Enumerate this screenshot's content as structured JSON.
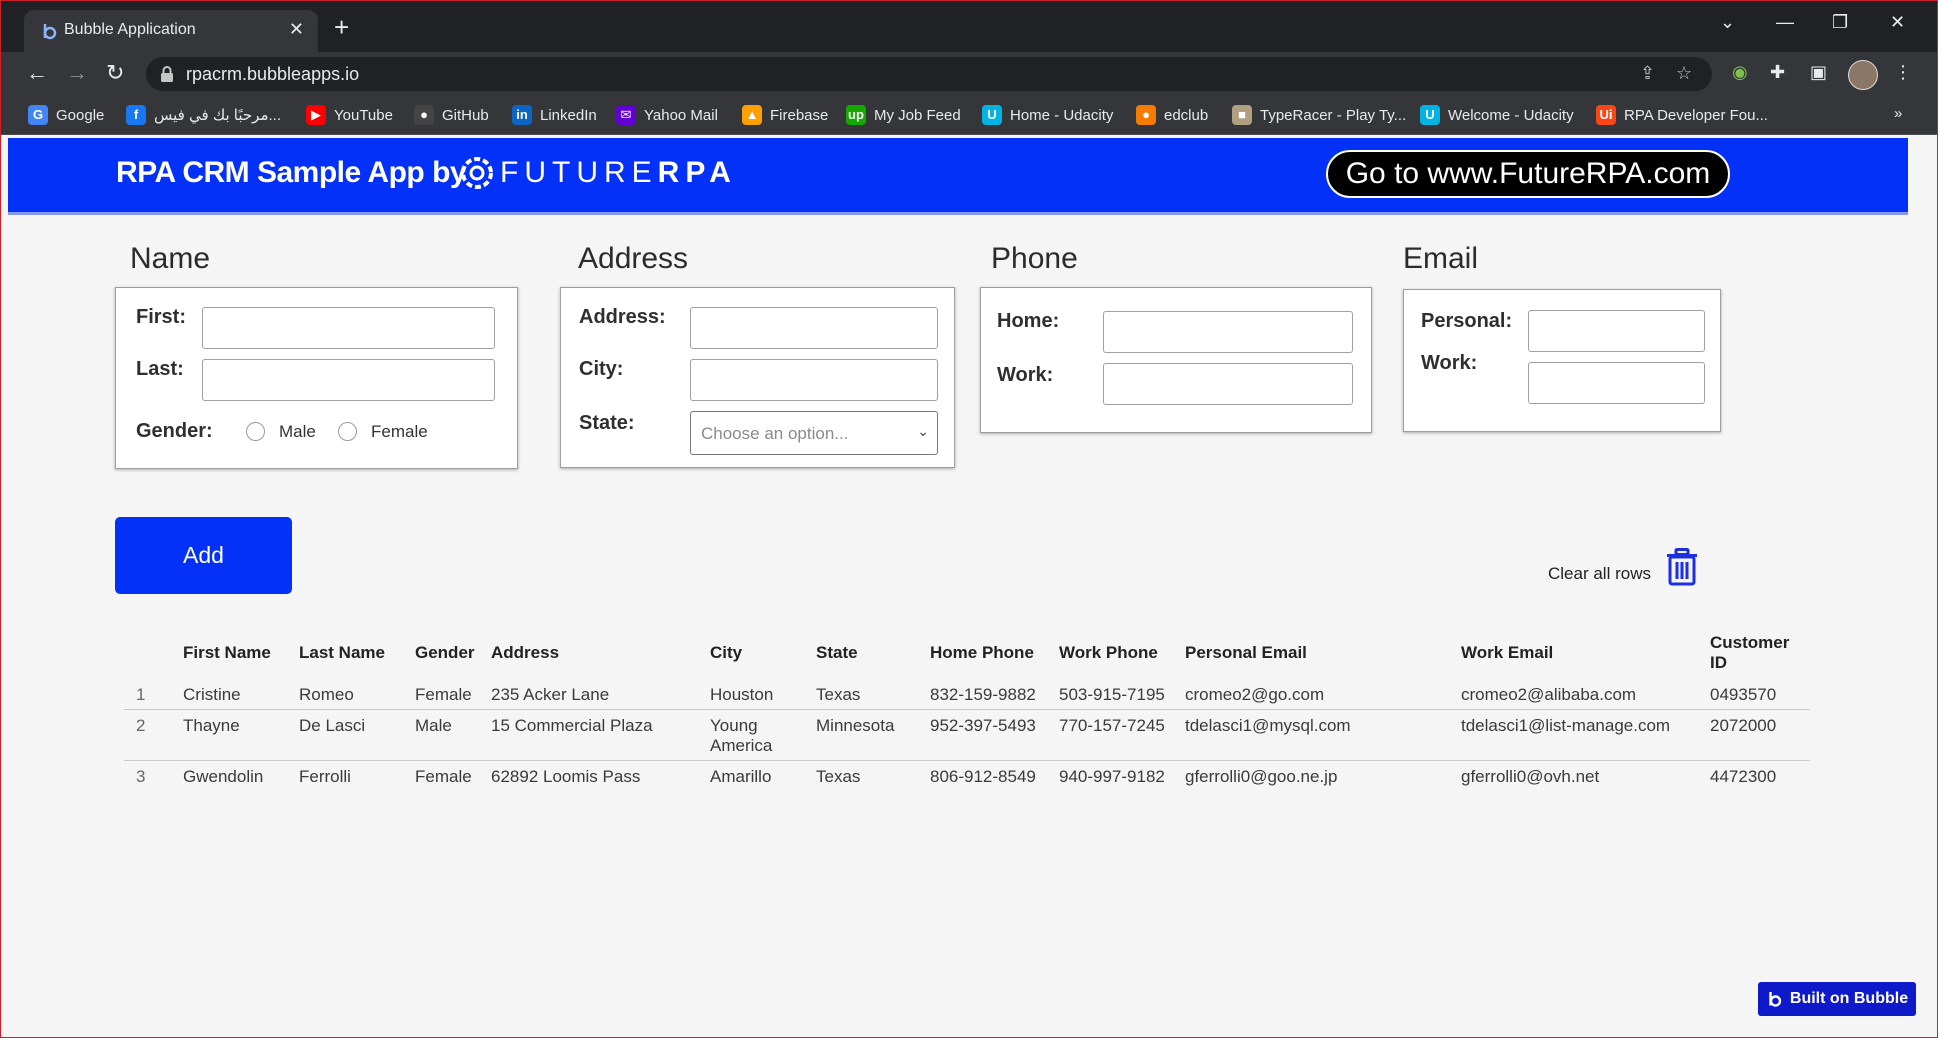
{
  "browser": {
    "tab_title": "Bubble Application",
    "url": "rpacrm.bubbleapps.io",
    "bookmarks": [
      {
        "label": "Google",
        "icon": "google-icon",
        "color": "#4285f4"
      },
      {
        "label": "مرحبًا بك في فيس...",
        "icon": "facebook-icon",
        "color": "#1877f2"
      },
      {
        "label": "YouTube",
        "icon": "youtube-icon",
        "color": "#ff0000"
      },
      {
        "label": "GitHub",
        "icon": "github-icon",
        "color": "#444444"
      },
      {
        "label": "LinkedIn",
        "icon": "linkedin-icon",
        "color": "#0a66c2"
      },
      {
        "label": "Yahoo Mail",
        "icon": "yahoo-mail-icon",
        "color": "#6001d2"
      },
      {
        "label": "Firebase",
        "icon": "firebase-icon",
        "color": "#ffa000"
      },
      {
        "label": "My Job Feed",
        "icon": "upwork-icon",
        "color": "#14a800"
      },
      {
        "label": "Home - Udacity",
        "icon": "udacity-icon",
        "color": "#02b3e4"
      },
      {
        "label": "edclub",
        "icon": "edclub-icon",
        "color": "#f57c00"
      },
      {
        "label": "TypeRacer - Play Ty...",
        "icon": "typeracer-icon",
        "color": "#b0a080"
      },
      {
        "label": "Welcome - Udacity",
        "icon": "udacity-icon",
        "color": "#02b3e4"
      },
      {
        "label": "RPA Developer Fou...",
        "icon": "uipath-icon",
        "color": "#fa4616"
      }
    ]
  },
  "header": {
    "title": "RPA CRM Sample App by",
    "brand_light": "FUTURE",
    "brand_bold": "RPA",
    "link_button": "Go to www.FutureRPA.com",
    "color": "#0431f8"
  },
  "name_section": {
    "title": "Name",
    "first_label": "First:",
    "last_label": "Last:",
    "gender_label": "Gender:",
    "male_label": "Male",
    "female_label": "Female"
  },
  "address_section": {
    "title": "Address",
    "address_label": "Address:",
    "city_label": "City:",
    "state_label": "State:",
    "state_placeholder": "Choose an option..."
  },
  "phone_section": {
    "title": "Phone",
    "home_label": "Home:",
    "work_label": "Work:"
  },
  "email_section": {
    "title": "Email",
    "personal_label": "Personal:",
    "work_label": "Work:"
  },
  "actions": {
    "add_label": "Add",
    "clear_label": "Clear all rows"
  },
  "table": {
    "columns": [
      "",
      "First Name",
      "Last Name",
      "Gender",
      "Address",
      "City",
      "State",
      "Home Phone",
      "Work Phone",
      "Personal Email",
      "Work Email",
      "Customer ID"
    ],
    "rows": [
      [
        "1",
        "Cristine",
        "Romeo",
        "Female",
        "235 Acker Lane",
        "Houston",
        "Texas",
        "832-159-9882",
        "503-915-7195",
        "cromeo2@go.com",
        "cromeo2@alibaba.com",
        "0493570"
      ],
      [
        "2",
        "Thayne",
        "De Lasci",
        "Male",
        "15 Commercial Plaza",
        "Young America",
        "Minnesota",
        "952-397-5493",
        "770-157-7245",
        "tdelasci1@mysql.com",
        "tdelasci1@list-manage.com",
        "2072000"
      ],
      [
        "3",
        "Gwendolin",
        "Ferrolli",
        "Female",
        "62892 Loomis Pass",
        "Amarillo",
        "Texas",
        "806-912-8549",
        "940-997-9182",
        "gferrolli0@goo.ne.jp",
        "gferrolli0@ovh.net",
        "4472300"
      ]
    ]
  },
  "footer": {
    "built_label": "Built on Bubble"
  }
}
